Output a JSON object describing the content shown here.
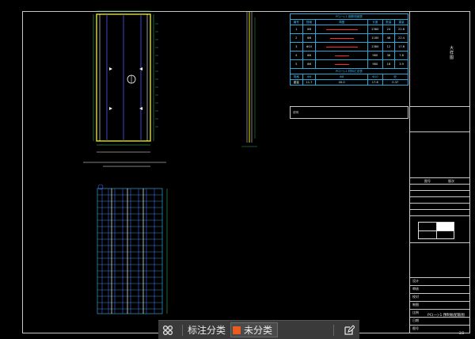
{
  "drawing": {
    "side_label": "大\n样\n图",
    "note_caption": "说明",
    "rebar_table_title": "PC(一)-1  钢筋明细表",
    "rebar_table_headers": [
      "编号",
      "规格",
      "简图",
      "长度",
      "数量",
      "重量"
    ],
    "rebar_rows": [
      [
        "1",
        "Φ8",
        "",
        "2380",
        "24",
        "22.6"
      ],
      [
        "2",
        "Φ8",
        "",
        "1180",
        "48",
        "22.4"
      ],
      [
        "3",
        "Φ10",
        "",
        "2380",
        "12",
        "17.6"
      ],
      [
        "4",
        "Φ6",
        "",
        "980",
        "36",
        "7.8"
      ],
      [
        "5",
        "Φ6",
        "",
        "980",
        "18",
        "3.9"
      ]
    ],
    "summary_title": "PC(一)-1  材料汇总表",
    "summary_headers": [
      "规格",
      "Φ6",
      "Φ8",
      "Φ10",
      "砼"
    ],
    "summary_row": [
      "重量",
      "11.7",
      "45.0",
      "17.6",
      "0.37"
    ],
    "title_block": {
      "labels": [
        "设计",
        "审核",
        "校对",
        "制图",
        "比例",
        "日期",
        "图号"
      ],
      "drawing_name": "PC(一)-1 预制板配筋图",
      "page_number": "2/2",
      "col_a": "图号",
      "col_b": "版次"
    }
  },
  "toolbar": {
    "grid_icon": "grid-icon",
    "label": "标注分类",
    "category_value": "未分类",
    "category_color": "#e85c1f",
    "edit_icon": "edit-note-icon"
  },
  "colors": {
    "frame": "#c8c8c8",
    "panel_outline": "#e6e600",
    "rebar_blue": "#4a5cff",
    "rebar_cyan": "#39c0f0",
    "dim_green": "#3bd16f",
    "accent_red": "#ff2a2a"
  }
}
